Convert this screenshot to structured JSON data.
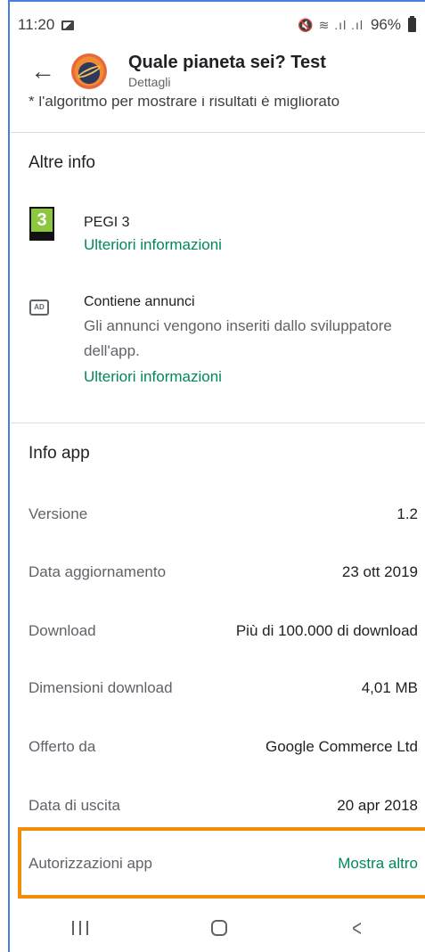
{
  "status_bar": {
    "time": "11:20",
    "battery": "96%",
    "signal_icons": "🔇 ≋ .ıl .ıl"
  },
  "app_bar": {
    "title": "Quale pianeta sei? Test",
    "subtitle": "Dettagli",
    "back_icon": "arrow-back-icon",
    "app_icon": "planet-app-icon"
  },
  "clipped_text": "* l'algoritmo per mostrare i risultati è migliorato",
  "altre_info": {
    "heading": "Altre info",
    "pegi": {
      "badge_number": "3",
      "title": "PEGI 3",
      "link": "Ulteriori informazioni"
    },
    "ads": {
      "icon_text": "AD",
      "title": "Contiene annunci",
      "description": "Gli annunci vengono inseriti dallo sviluppatore dell'app.",
      "link": "Ulteriori informazioni"
    }
  },
  "info_app": {
    "heading": "Info app",
    "rows": [
      {
        "label": "Versione",
        "value": "1.2"
      },
      {
        "label": "Data aggiornamento",
        "value": "23 ott 2019"
      },
      {
        "label": "Download",
        "value": "Più di 100.000 di download"
      },
      {
        "label": "Dimensioni download",
        "value": "4,01 MB"
      },
      {
        "label": "Offerto da",
        "value": "Google Commerce Ltd"
      },
      {
        "label": "Data di uscita",
        "value": "20 apr 2018"
      }
    ],
    "permissions": {
      "label": "Autorizzazioni app",
      "link": "Mostra altro"
    }
  },
  "colors": {
    "accent_green": "#01875f",
    "highlight_orange": "#f58c06",
    "frame_blue": "#4a7de1"
  }
}
